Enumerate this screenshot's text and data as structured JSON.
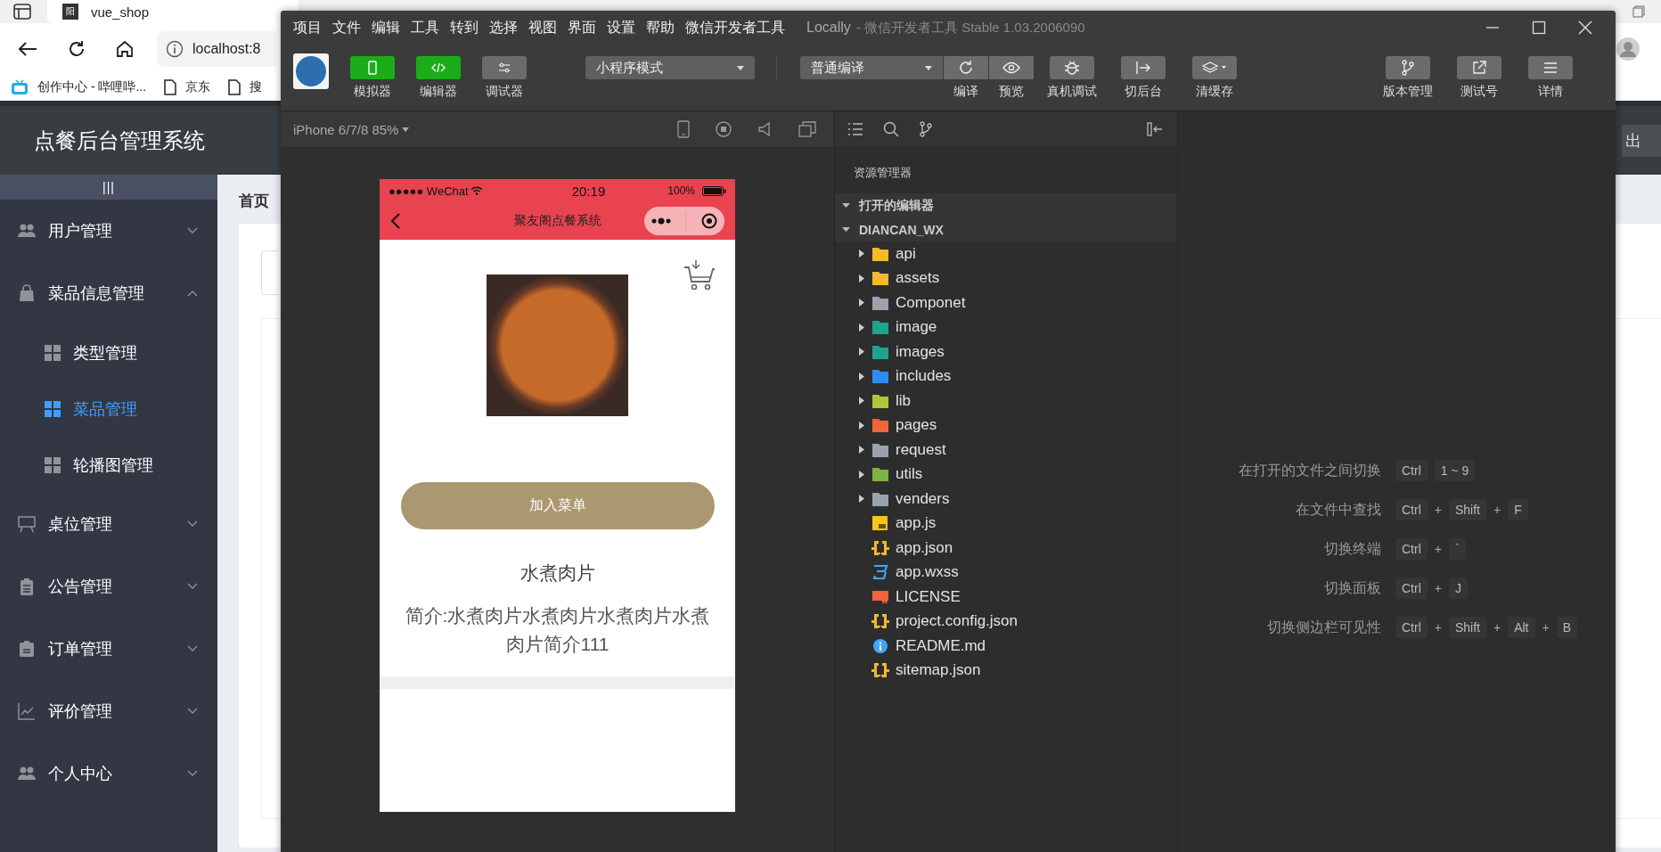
{
  "browser": {
    "tab": {
      "favicon": "阳",
      "title": "vue_shop"
    },
    "address": "localhost:8",
    "bookmarks": [
      "创作中心 - 哔哩哔...",
      "京东",
      "搜"
    ]
  },
  "app": {
    "title": "点餐后台管理系统",
    "collapse": "|||",
    "logout": "出",
    "breadcrumb": "首页",
    "menu": [
      {
        "label": "用户管理",
        "expanded": false
      },
      {
        "label": "菜品信息管理",
        "expanded": true,
        "children": [
          {
            "label": "类型管理",
            "selected": false
          },
          {
            "label": "菜品管理",
            "selected": true
          },
          {
            "label": "轮播图管理",
            "selected": false
          }
        ]
      },
      {
        "label": "桌位管理",
        "expanded": false
      },
      {
        "label": "公告管理",
        "expanded": false
      },
      {
        "label": "订单管理",
        "expanded": false
      },
      {
        "label": "评价管理",
        "expanded": false
      },
      {
        "label": "个人中心",
        "expanded": false
      }
    ]
  },
  "devtools": {
    "menu_bar": [
      "项目",
      "文件",
      "编辑",
      "工具",
      "转到",
      "选择",
      "视图",
      "界面",
      "设置",
      "帮助",
      "微信开发者工具"
    ],
    "title": "Locally",
    "subtitle": "- 微信开发者工具 Stable 1.03.2006090",
    "left_tools": [
      {
        "label": "模拟器",
        "on": true
      },
      {
        "label": "编辑器",
        "on": true
      },
      {
        "label": "调试器",
        "on": false
      }
    ],
    "mode_select": "小程序模式",
    "compile_select": "普通编译",
    "compile_tools": [
      "编译",
      "预览"
    ],
    "device_tools": [
      "真机调试",
      "切后台",
      "清缓存"
    ],
    "right_tools": [
      "版本管理",
      "测试号",
      "详情"
    ],
    "simulator": {
      "device": "iPhone 6/7/8 85%",
      "phone": {
        "carrier": "●●●●● WeChat",
        "time": "20:19",
        "battery": "100%",
        "nav_title": "聚友阁点餐系统",
        "add_button": "加入菜单",
        "dish_name": "水煮肉片",
        "description": "简介:水煮肉片水煮肉片水煮肉片水煮肉片简介111"
      }
    },
    "explorer": {
      "title": "资源管理器",
      "open_editors": {
        "label": "打开的编辑器",
        "expanded": true
      },
      "project": {
        "label": "DIANCAN_WX",
        "expanded": true
      },
      "files": [
        {
          "name": "api",
          "kind": "folder",
          "color": "#f5b82e",
          "expanded": false
        },
        {
          "name": "assets",
          "kind": "folder",
          "color": "#f5b82e",
          "expanded": false
        },
        {
          "name": "Componet",
          "kind": "folder",
          "color": "#9aa3ad",
          "expanded": false
        },
        {
          "name": "image",
          "kind": "folder",
          "color": "#1fa38a",
          "expanded": false
        },
        {
          "name": "images",
          "kind": "folder",
          "color": "#1fa38a",
          "expanded": false
        },
        {
          "name": "includes",
          "kind": "folder",
          "color": "#2d8cf0",
          "expanded": false
        },
        {
          "name": "lib",
          "kind": "folder",
          "color": "#b5c43a",
          "expanded": false
        },
        {
          "name": "pages",
          "kind": "folder",
          "color": "#f0643c",
          "expanded": false
        },
        {
          "name": "request",
          "kind": "folder",
          "color": "#9aa3ad",
          "expanded": false
        },
        {
          "name": "utils",
          "kind": "folder",
          "color": "#7cb342",
          "expanded": false
        },
        {
          "name": "venders",
          "kind": "folder",
          "color": "#9aa3ad",
          "expanded": false
        },
        {
          "name": "app.js",
          "kind": "js",
          "color": "#f5c518"
        },
        {
          "name": "app.json",
          "kind": "json",
          "color": "#f5b82e"
        },
        {
          "name": "app.wxss",
          "kind": "css",
          "color": "#42a5f5"
        },
        {
          "name": "LICENSE",
          "kind": "license",
          "color": "#f0643c"
        },
        {
          "name": "project.config.json",
          "kind": "json",
          "color": "#f5b82e"
        },
        {
          "name": "README.md",
          "kind": "info",
          "color": "#42a5f5"
        },
        {
          "name": "sitemap.json",
          "kind": "json",
          "color": "#f5b82e"
        }
      ]
    },
    "shortcuts": [
      {
        "label": "在打开的文件之间切换",
        "keys": [
          {
            "kind": "key",
            "text": "Ctrl"
          },
          {
            "kind": "key",
            "text": "1 ~ 9"
          }
        ]
      },
      {
        "label": "在文件中查找",
        "keys": [
          {
            "kind": "key",
            "text": "Ctrl"
          },
          {
            "kind": "plus",
            "text": "+"
          },
          {
            "kind": "key",
            "text": "Shift"
          },
          {
            "kind": "plus",
            "text": "+"
          },
          {
            "kind": "key",
            "text": "F"
          }
        ]
      },
      {
        "label": "切换终端",
        "keys": [
          {
            "kind": "key",
            "text": "Ctrl"
          },
          {
            "kind": "plus",
            "text": "+"
          },
          {
            "kind": "key",
            "text": "`"
          }
        ]
      },
      {
        "label": "切换面板",
        "keys": [
          {
            "kind": "key",
            "text": "Ctrl"
          },
          {
            "kind": "plus",
            "text": "+"
          },
          {
            "kind": "key",
            "text": "J"
          }
        ]
      },
      {
        "label": "切换侧边栏可见性",
        "keys": [
          {
            "kind": "key",
            "text": "Ctrl"
          },
          {
            "kind": "plus",
            "text": "+"
          },
          {
            "kind": "key",
            "text": "Shift"
          },
          {
            "kind": "plus",
            "text": "+"
          },
          {
            "kind": "key",
            "text": "Alt"
          },
          {
            "kind": "plus",
            "text": "+"
          },
          {
            "kind": "key",
            "text": "B"
          }
        ]
      }
    ]
  }
}
